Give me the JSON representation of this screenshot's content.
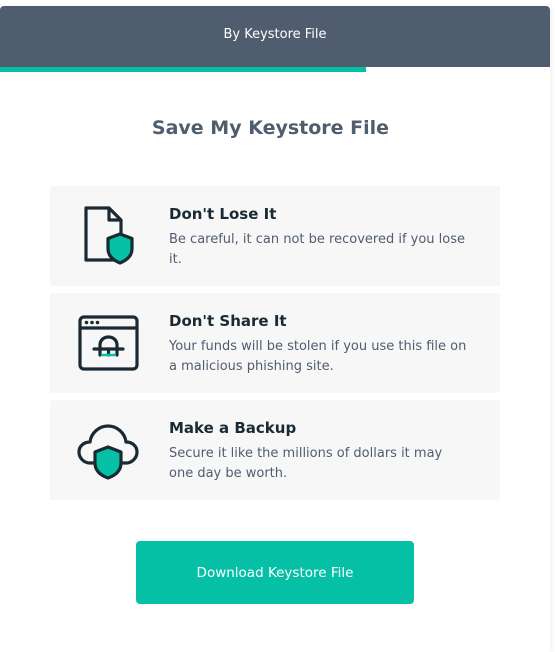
{
  "header": {
    "title": "By Keystore File"
  },
  "progress": {
    "fraction": 0.665
  },
  "main": {
    "title": "Save My Keystore File",
    "tips": [
      {
        "icon": "file-shield-icon",
        "title": "Don't Lose It",
        "description": "Be careful, it can not be recovered if you lose it."
      },
      {
        "icon": "phishing-browser-icon",
        "title": "Don't Share It",
        "description": "Your funds will be stolen if you use this file on a malicious phishing site."
      },
      {
        "icon": "cloud-shield-icon",
        "title": "Make a Backup",
        "description": "Secure it like the millions of dollars it may one day be worth."
      }
    ],
    "download_label": "Download Keystore File"
  },
  "colors": {
    "header_bg": "#505d6f",
    "accent": "#05c0a5",
    "icon_dark": "#1a2a33",
    "tip_bg": "#f7f7f7"
  }
}
